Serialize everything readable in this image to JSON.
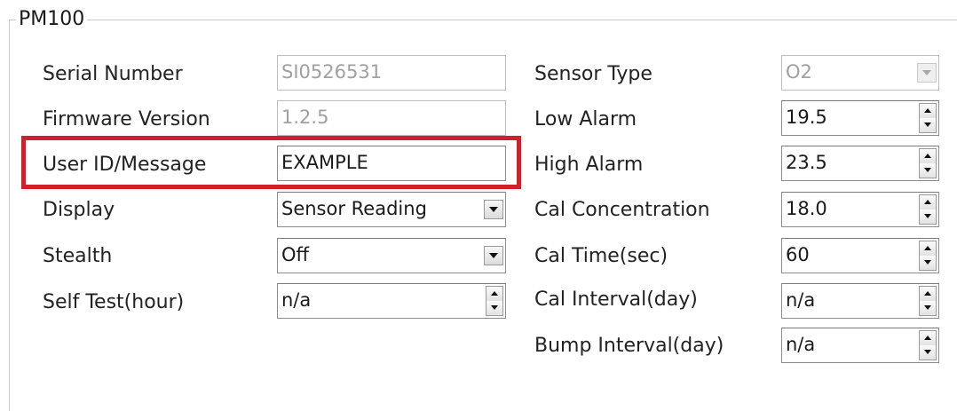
{
  "group": {
    "title": "PM100"
  },
  "left": {
    "serial_number": {
      "label": "Serial Number",
      "value": "SI0526531"
    },
    "firmware_version": {
      "label": "Firmware Version",
      "value": "1.2.5"
    },
    "user_id": {
      "label": "User ID/Message",
      "value": "EXAMPLE"
    },
    "display": {
      "label": "Display",
      "value": "Sensor Reading"
    },
    "stealth": {
      "label": "Stealth",
      "value": "Off"
    },
    "self_test": {
      "label": "Self Test(hour)",
      "value": "n/a"
    }
  },
  "right": {
    "sensor_type": {
      "label": "Sensor Type",
      "value": "O2"
    },
    "low_alarm": {
      "label": "Low Alarm",
      "value": "19.5"
    },
    "high_alarm": {
      "label": "High Alarm",
      "value": "23.5"
    },
    "cal_concentration": {
      "label": "Cal Concentration",
      "value": "18.0"
    },
    "cal_time": {
      "label": "Cal Time(sec)",
      "value": "60"
    },
    "cal_interval": {
      "label": "Cal Interval(day)",
      "value": "n/a"
    },
    "bump_interval": {
      "label": "Bump Interval(day)",
      "value": "n/a"
    }
  },
  "colors": {
    "highlight": "#d21f2b",
    "disabled_text": "#a0a0a0",
    "border": "#8c8c8c"
  }
}
